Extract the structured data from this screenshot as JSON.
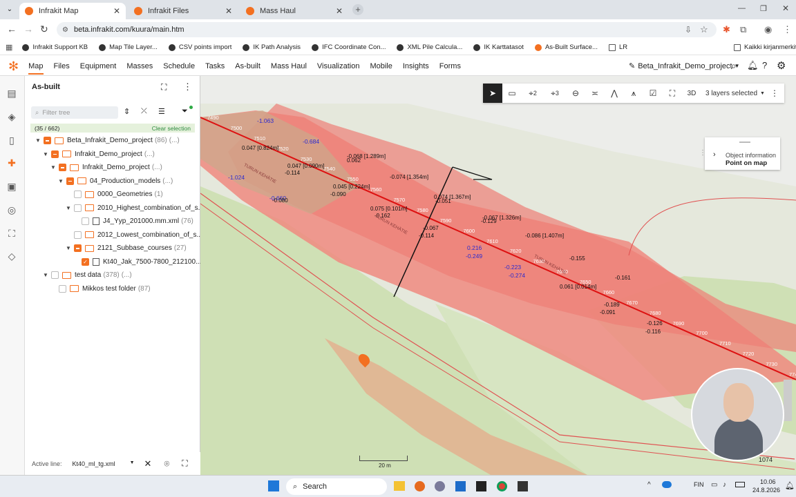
{
  "browser": {
    "tabs": [
      {
        "label": "Infrakit Map",
        "active": true
      },
      {
        "label": "Infrakit Files",
        "active": false
      },
      {
        "label": "Mass Haul",
        "active": false
      }
    ],
    "url": "beta.infrakit.com/kuura/main.htm",
    "bookmarks": [
      "Infrakit Support KB",
      "Map Tile Layer...",
      "CSV points import",
      "IK Path Analysis",
      "IFC Coordinate Con...",
      "XML Pile Calcula...",
      "IK Karttatasot",
      "As-Built Surface...",
      "LR"
    ],
    "all_bookmarks": "Kaikki kirjanmerkit"
  },
  "app": {
    "nav": [
      "Map",
      "Files",
      "Equipment",
      "Masses",
      "Schedule",
      "Tasks",
      "As-built",
      "Mass Haul",
      "Visualization",
      "Mobile",
      "Insights",
      "Forms"
    ],
    "active_nav": "Map",
    "project": "Beta_Infrakit_Demo_project",
    "accent": "#f37021"
  },
  "panel": {
    "title": "As-built",
    "filter_placeholder": "Filter tree",
    "count": "(35 / 662)",
    "clear": "Clear selection",
    "tree": [
      {
        "label": "Beta_Infrakit_Demo_project",
        "count": "(86)",
        "extra": "(...)",
        "indent": 0,
        "chevron": "down",
        "check": "partial",
        "kind": "folder"
      },
      {
        "label": "Infrakit_Demo_project",
        "count": "",
        "extra": "(...)",
        "indent": 1,
        "chevron": "down",
        "check": "partial",
        "kind": "folder"
      },
      {
        "label": "Infrakit_Demo_project",
        "count": "",
        "extra": "(...)",
        "indent": 2,
        "chevron": "down",
        "check": "partial",
        "kind": "folder"
      },
      {
        "label": "04_Production_models",
        "count": "",
        "extra": "(...)",
        "indent": 3,
        "chevron": "down",
        "check": "partial",
        "kind": "folder"
      },
      {
        "label": "0000_Geometries",
        "count": "(1)",
        "extra": "",
        "indent": 4,
        "chevron": "",
        "check": "none",
        "kind": "folder"
      },
      {
        "label": "2010_Highest_combination_of_s...",
        "count": "",
        "extra": "",
        "indent": 4,
        "chevron": "down",
        "check": "none",
        "kind": "folder"
      },
      {
        "label": "J4_Yyp_201000.mm.xml",
        "count": "(76)",
        "extra": "",
        "indent": 5,
        "chevron": "",
        "check": "none",
        "kind": "file"
      },
      {
        "label": "2012_Lowest_combination_of_s...",
        "count": "",
        "extra": "",
        "indent": 4,
        "chevron": "",
        "check": "none",
        "kind": "folder"
      },
      {
        "label": "2121_Subbase_courses",
        "count": "(27)",
        "extra": "",
        "indent": 4,
        "chevron": "down",
        "check": "partial",
        "kind": "folder"
      },
      {
        "label": "Kt40_Jak_7500-7800_212100...",
        "count": "",
        "extra": "",
        "indent": 5,
        "chevron": "",
        "check": "checked",
        "kind": "file"
      },
      {
        "label": "test data",
        "count": "(378)",
        "extra": "(...)",
        "indent": 1,
        "chevron": "down",
        "check": "none",
        "kind": "folder"
      },
      {
        "label": "Mikkos test folder",
        "count": "(87)",
        "extra": "",
        "indent": 2,
        "chevron": "",
        "check": "none",
        "kind": "folder"
      }
    ],
    "active_line_label": "Active line:",
    "active_line_value": "Kt40_ml_tg.xml"
  },
  "map": {
    "layers": "3 layers selected",
    "tool_3d": "3D",
    "tool_count_a": "2",
    "tool_count_b": "3",
    "objinfo_title": "Object information",
    "objinfo_value": "Point on map",
    "scale": "20 m",
    "zoom": "1074",
    "road_label": "TURUN KEHÄTIE",
    "stations": [
      "7490",
      "7500",
      "7510",
      "7520",
      "7530",
      "7540",
      "7550",
      "7560",
      "7570",
      "7580",
      "7590",
      "7600",
      "7610",
      "7620",
      "7630",
      "7640",
      "7650",
      "7660",
      "7670",
      "7680",
      "7690",
      "7700",
      "7710",
      "7720",
      "7730",
      "7740"
    ],
    "points_blue": [
      "-1.063",
      "-0.684",
      "-1.024",
      "-0.660",
      "0.216",
      "-0.249",
      "-0.223",
      "-0.274"
    ],
    "points_black": [
      "0.047 [0.824m]",
      "-0.068 [1.289m]",
      "0.047 [0.090m]",
      "-0.114",
      "0.062",
      "-0.074 [1.354m]",
      "0.045 [0.224m]",
      "-0.090",
      "-0.080",
      "0.074 [1.367m]",
      "-0.051",
      "0.075 [0.101m]",
      "-0.162",
      "-0.067 [1.326m]",
      "-0.129",
      "-0.067",
      "-0.114",
      "-0.086 [1.407m]",
      "-0.155",
      "-0.161",
      "0.061 [0.014m]",
      "-0.189",
      "-0.091",
      "-0.126",
      "-0.116"
    ]
  },
  "taskbar": {
    "search": "Search",
    "lang": "FIN",
    "time": "10.06",
    "date": "24.8.2026"
  }
}
